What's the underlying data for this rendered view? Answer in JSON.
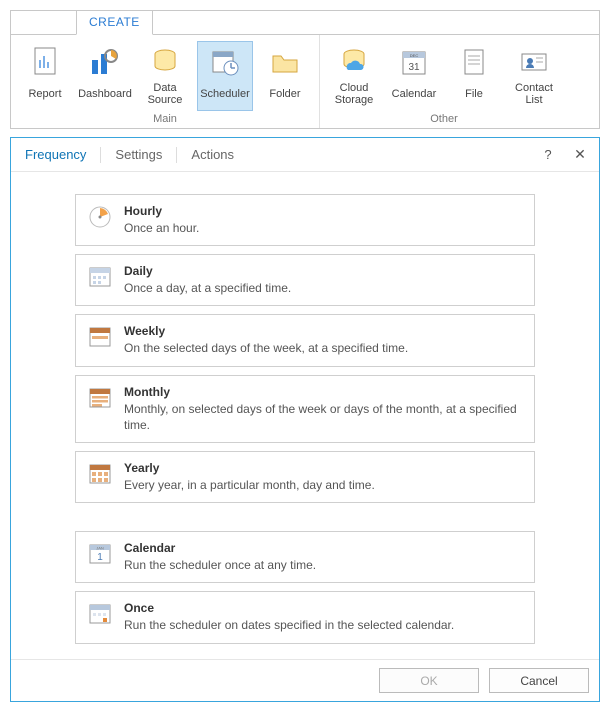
{
  "ribbon": {
    "tab": "CREATE",
    "groups": [
      {
        "caption": "Main",
        "items": [
          {
            "name": "report",
            "label": "Report",
            "icon": "report-icon"
          },
          {
            "name": "dashboard",
            "label": "Dashboard",
            "icon": "dashboard-icon"
          },
          {
            "name": "datasource",
            "label": "Data Source",
            "icon": "datasource-icon"
          },
          {
            "name": "scheduler",
            "label": "Scheduler",
            "icon": "scheduler-icon",
            "active": true
          },
          {
            "name": "folder",
            "label": "Folder",
            "icon": "folder-icon"
          }
        ]
      },
      {
        "caption": "Other",
        "items": [
          {
            "name": "cloud",
            "label": "Cloud Storage",
            "icon": "cloud-icon"
          },
          {
            "name": "calendar",
            "label": "Calendar",
            "icon": "calendar-icon"
          },
          {
            "name": "file",
            "label": "File",
            "icon": "file-icon"
          },
          {
            "name": "contacts",
            "label": "Contact List",
            "icon": "contact-icon"
          }
        ]
      }
    ]
  },
  "dialog": {
    "tabs": [
      "Frequency",
      "Settings",
      "Actions"
    ],
    "selected_tab_index": 0,
    "help_symbol": "?",
    "close_symbol": "✕",
    "options": [
      {
        "key": "hourly",
        "title": "Hourly",
        "desc": "Once an hour.",
        "icon": "hourly-icon"
      },
      {
        "key": "daily",
        "title": "Daily",
        "desc": "Once a day, at a specified time.",
        "icon": "daily-icon"
      },
      {
        "key": "weekly",
        "title": "Weekly",
        "desc": "On the selected days of the week, at a specified time.",
        "icon": "weekly-icon"
      },
      {
        "key": "monthly",
        "title": "Monthly",
        "desc": "Monthly, on selected days of the week or days of the month, at a specified time.",
        "icon": "monthly-icon"
      },
      {
        "key": "yearly",
        "title": "Yearly",
        "desc": "Every year, in a particular month, day and time.",
        "icon": "yearly-icon"
      },
      {
        "key": "calendar",
        "title": "Calendar",
        "desc": "Run the scheduler once at any time.",
        "icon": "calendar-opt-icon",
        "gap_before": true
      },
      {
        "key": "once",
        "title": "Once",
        "desc": "Run the scheduler on dates specified in the selected calendar.",
        "icon": "once-icon"
      }
    ],
    "buttons": {
      "ok": {
        "label": "OK",
        "enabled": false
      },
      "cancel": {
        "label": "Cancel",
        "enabled": true
      }
    }
  }
}
